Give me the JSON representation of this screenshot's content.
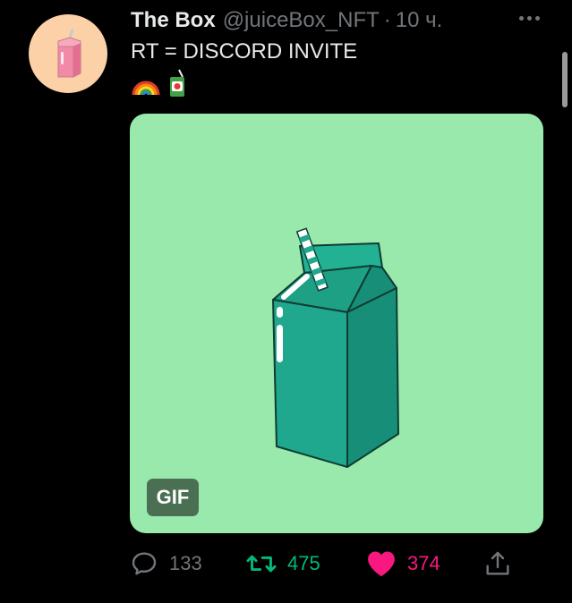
{
  "tweet": {
    "author_name": "The Box",
    "handle": "@juiceBox_NFT",
    "separator": "·",
    "time": "10 ч.",
    "text": "RT = DISCORD INVITE",
    "emojis": [
      "rainbow-emoji",
      "juice-box-emoji"
    ]
  },
  "media": {
    "badge": "GIF",
    "background": "#98e9ab",
    "subject": "teal-milk-carton-with-straw"
  },
  "actions": {
    "replies": "133",
    "retweets": "475",
    "likes": "374"
  },
  "colors": {
    "background": "#000000",
    "text_primary": "#e7e9ea",
    "text_secondary": "#71767b",
    "retweet_green": "#00ba7c",
    "like_pink": "#f91880",
    "carton_teal": "#1fa88e"
  }
}
